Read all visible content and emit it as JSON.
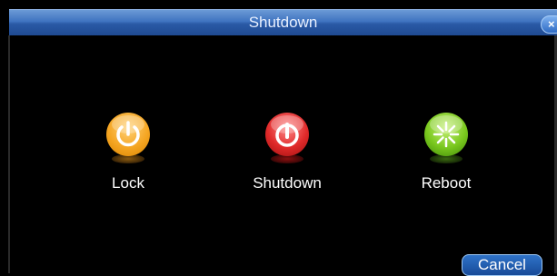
{
  "window": {
    "title": "Shutdown",
    "close_icon": "close-icon"
  },
  "actions": [
    {
      "label": "Lock",
      "icon": "lock-power-icon",
      "color": "#f5a623"
    },
    {
      "label": "Shutdown",
      "icon": "shutdown-power-icon",
      "color": "#e02a2a"
    },
    {
      "label": "Reboot",
      "icon": "reboot-burst-icon",
      "color": "#7ac81e"
    }
  ],
  "footer": {
    "cancel_label": "Cancel"
  },
  "colors": {
    "titlebar": "#3f73c0",
    "background": "#000000",
    "button_border": "#9cc6f2"
  }
}
